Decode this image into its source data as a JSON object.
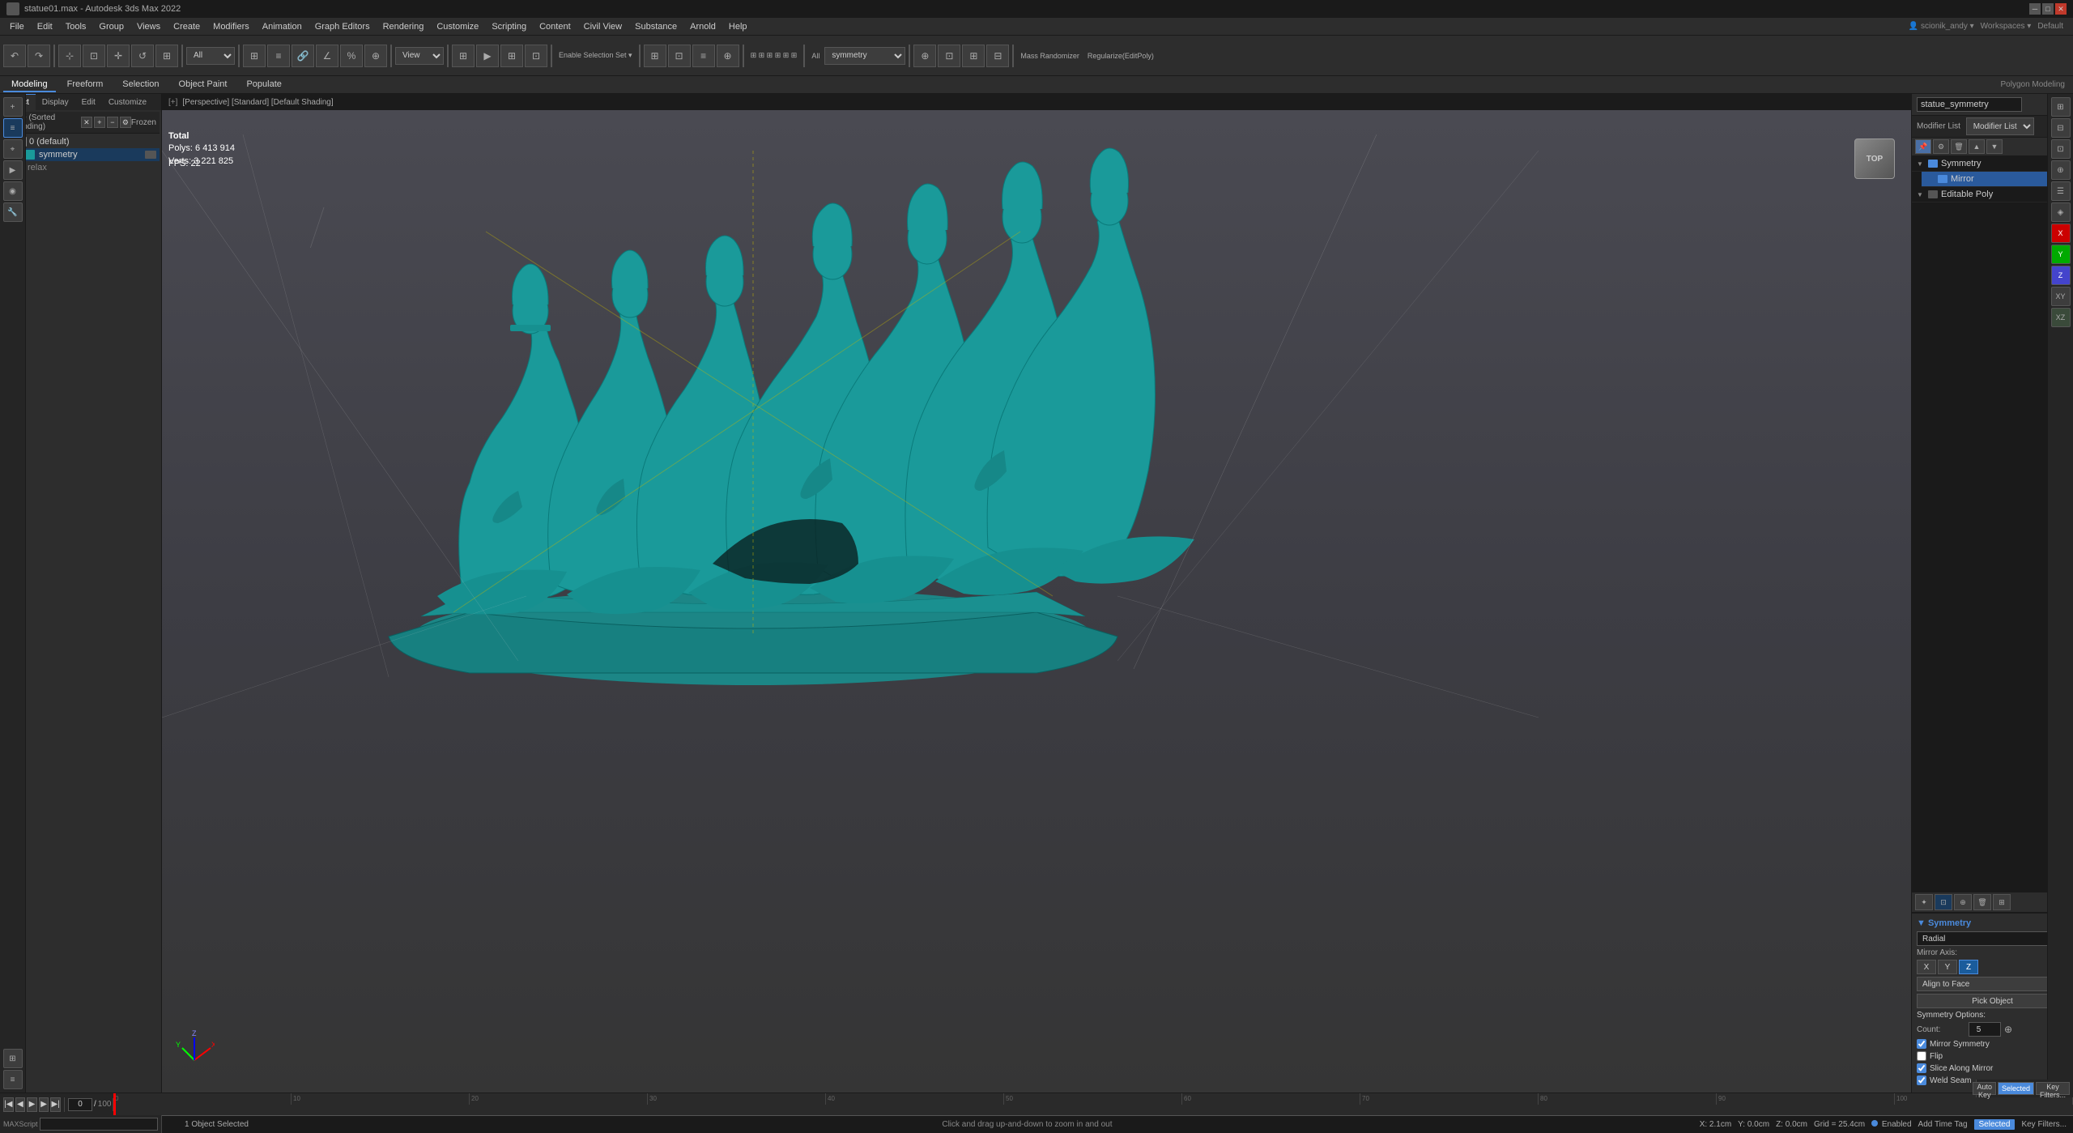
{
  "app": {
    "title": "statue01.max - Autodesk 3ds Max 2022",
    "version": "2022"
  },
  "titlebar": {
    "title": "statue01.max - Autodesk 3ds Max 2022"
  },
  "menubar": {
    "items": [
      "File",
      "Edit",
      "Tools",
      "Group",
      "Views",
      "Create",
      "Modifiers",
      "Animation",
      "Graph Editors",
      "Rendering",
      "Customize",
      "Scripting",
      "Content",
      "Civil View",
      "Substance",
      "Arnold",
      "Help"
    ]
  },
  "toolbar": {
    "dropdown_mode": "All",
    "dropdown_view": "View",
    "mass_randomizer": "Mass Randomizer",
    "regularize": "Regularize(EditPoly)"
  },
  "secondary_toolbar": {
    "tabs": [
      "Modeling",
      "Freeform",
      "Selection",
      "Object Paint",
      "Populate"
    ]
  },
  "left_panel": {
    "tabs": [
      "Select",
      "Display",
      "Edit",
      "Customize"
    ],
    "tree_header": "Name (Sorted Ascending)",
    "frozen_label": "Frozen",
    "items": [
      {
        "label": "0 (default)",
        "type": "layer",
        "expanded": true,
        "children": [
          {
            "label": "symmetry",
            "type": "object",
            "selected": true,
            "children": [
              {
                "label": "relax",
                "type": "sub"
              }
            ]
          }
        ]
      }
    ]
  },
  "viewport": {
    "header": "[+] [Perspective] [Standard] [Default Shading]",
    "poly_label": "Total",
    "poly_count": "6 413 914",
    "vert_count": "3 221 825",
    "fps_label": "FPS:",
    "fps_value": "22"
  },
  "right_panel": {
    "object_name": "statue_symmetry",
    "modifier_list_label": "Modifier List",
    "modifiers": [
      {
        "label": "Symmetry",
        "active": true
      },
      {
        "label": "Mirror",
        "selected": true,
        "highlighted": true
      },
      {
        "label": "Editable Poly",
        "active": true
      }
    ],
    "symmetry_props": {
      "title": "Symmetry",
      "mirror_axis_label": "Mirror Axis:",
      "axes": [
        "X",
        "Y",
        "Z"
      ],
      "active_axis": "Z",
      "align_to_face_label": "Align to Face",
      "pick_object_label": "Pick Object",
      "options_title": "Symmetry Options:",
      "count_label": "Count:",
      "count_value": "5",
      "mirror_symmetry_label": "Mirror Symmetry",
      "mirror_symmetry_checked": true,
      "flip_label": "Flip",
      "flip_checked": false,
      "slice_along_mirror_label": "Slice Along Mirror",
      "slice_along_mirror_checked": true,
      "weld_seam_label": "Weld Seam",
      "weld_seam_checked": true
    }
  },
  "timeline": {
    "frame_current": "0",
    "frame_total": "100",
    "ticks": [
      "0",
      "10",
      "20",
      "30",
      "40",
      "50",
      "60",
      "70",
      "80",
      "90",
      "100"
    ]
  },
  "status_bar": {
    "selected_count": "1 Object Selected",
    "hint": "Click and drag up-and-down to zoom in and out",
    "coordinates": {
      "x": "X: 2.1cm",
      "y": "Y: 0.0cm",
      "z": "Z: 0.0cm"
    },
    "grid_label": "Grid = 25.4cm",
    "enabled_label": "Enabled",
    "add_time_tag": "Add Time Tag",
    "auto_key_label": "Auto Key",
    "selected_badge": "Selected",
    "key_filters_label": "Key Filters..."
  },
  "far_left_icons": [
    "☰",
    "✦",
    "□",
    "◇",
    "△",
    "○",
    "⊞",
    "⊟",
    "⊕",
    "⊗",
    "☆",
    "⋮"
  ],
  "far_right_icons": [
    "◀",
    "▶",
    "⊡",
    "⊞",
    "☰",
    "⊕"
  ],
  "colors": {
    "accent": "#4a8adc",
    "teal": "#1a8080",
    "model_color": "#1a9a9a",
    "bg_dark": "#2d2d2d",
    "bg_darker": "#1a1a1a",
    "selected": "#2a5a9c"
  }
}
